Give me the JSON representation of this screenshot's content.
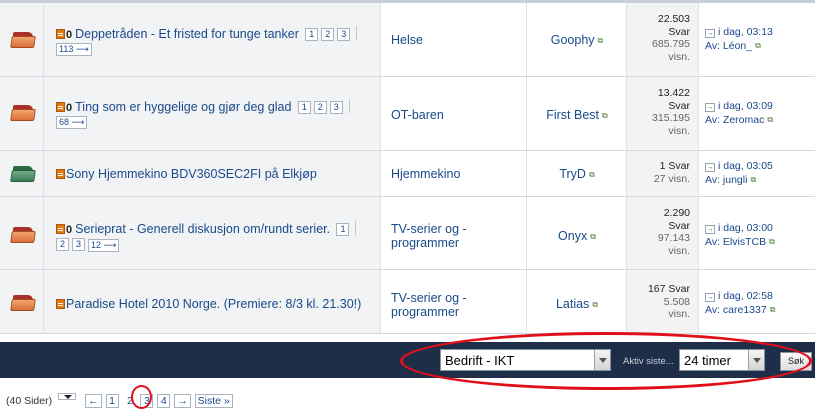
{
  "threads": [
    {
      "title": "Deppetråden - Et fristed for tunge tanker",
      "pages": [
        "1",
        "2",
        "3"
      ],
      "last_page": "113",
      "forum": "Helse",
      "author": "Goophy",
      "replies": "22.503",
      "replies_label": "Svar",
      "views": "685.795",
      "views_label": "visn.",
      "last_time": "i dag, 03:13",
      "last_by_prefix": "Av:",
      "last_by": "Léon_",
      "icon": "folder-hot-icon"
    },
    {
      "title": "Ting som er hyggelige og gjør deg glad",
      "pages": [
        "1",
        "2",
        "3"
      ],
      "last_page": "68",
      "forum": "OT-baren",
      "author": "First Best",
      "replies": "13.422",
      "replies_label": "Svar",
      "views": "315.195",
      "views_label": "visn.",
      "last_time": "i dag, 03:09",
      "last_by_prefix": "Av:",
      "last_by": "Zeromac",
      "icon": "folder-hot-icon"
    },
    {
      "title": "Sony Hjemmekino BDV360SEC2FI på Elkjøp",
      "forum": "Hjemmekino",
      "author": "TryD",
      "replies": "1 Svar",
      "views": "27 visn.",
      "last_time": "i dag, 03:05",
      "last_by_prefix": "Av:",
      "last_by": "jungli",
      "icon": "folder-cool-icon"
    },
    {
      "title": "Serieprat - Generell diskusjon om/rundt serier.",
      "pages_line1": [
        "1"
      ],
      "pages_line2": [
        "2",
        "3"
      ],
      "last_page": "12",
      "forum_line1": "TV-serier og -",
      "forum_line2": "programmer",
      "author": "Onyx",
      "replies": "2.290",
      "replies_label": "Svar",
      "views": "97.143",
      "views_label": "visn.",
      "last_time": "i dag, 03:00",
      "last_by_prefix": "Av:",
      "last_by": "ElvisTCB",
      "icon": "folder-hot-icon"
    },
    {
      "title": "Paradise Hotel 2010 Norge. (Premiere: 8/3 kl. 21.30!)",
      "forum_line1": "TV-serier og -",
      "forum_line2": "programmer",
      "author": "Latias",
      "replies": "167 Svar",
      "views": "5.508",
      "views_label": "visn.",
      "last_time": "i dag, 02:58",
      "last_by_prefix": "Av:",
      "last_by": "care1337",
      "icon": "folder-hot-icon"
    }
  ],
  "filter": {
    "category_value": "Bedrift - IKT",
    "active_label": "Aktiv siste...",
    "period_value": "24 timer",
    "search_button": "Søk"
  },
  "pager": {
    "total": "(40 Sider)",
    "prev": "←",
    "pages": [
      "1",
      "2",
      "3",
      "4"
    ],
    "current": "2",
    "next": "→",
    "last": "Siste »"
  },
  "colors": {
    "link": "#1a4a8a",
    "bar": "#1e2d48",
    "highlight": "#e0101a"
  }
}
